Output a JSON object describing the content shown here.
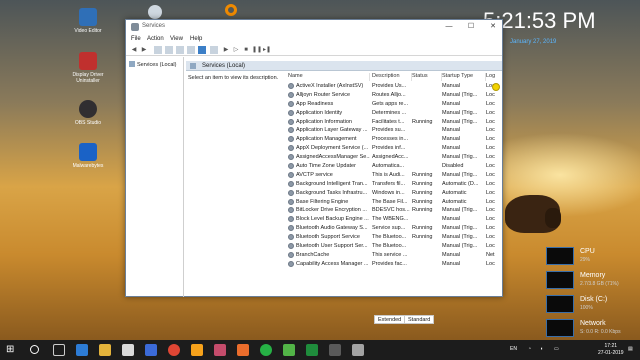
{
  "desktop": {
    "clock": "5:21:53 PM",
    "date": "January 27, 2019",
    "icons": [
      {
        "label": "Video Editor",
        "color": "#2f6fb7"
      },
      {
        "label": "Display Driver Uninstaller",
        "color": "#c0302e"
      },
      {
        "label": "OBS Studio",
        "color": "#302e31"
      },
      {
        "label": "Malwarebytes",
        "color": "#1a62c6"
      }
    ]
  },
  "perf_widget": [
    {
      "title": "CPU",
      "value": "29%"
    },
    {
      "title": "Memory",
      "value": "2.7/3.8 GB (71%)"
    },
    {
      "title": "Disk (C:)",
      "value": "100%"
    },
    {
      "title": "Network",
      "value": "S: 0.0 R: 0.0 Kbps"
    }
  ],
  "window": {
    "title": "Services",
    "buttons": {
      "minimize": "—",
      "maximize": "☐",
      "close": "✕"
    },
    "menu": [
      "File",
      "Action",
      "View",
      "Help"
    ],
    "left_pane_label": "Services (Local)",
    "header_label": "Services (Local)",
    "description_text": "Select an item to view its description.",
    "columns": [
      "Name",
      "Description",
      "Status",
      "Startup Type",
      "Log"
    ],
    "services": [
      {
        "name": "ActiveX Installer (AxInstSV)",
        "desc": "Provides Us...",
        "status": "",
        "startup": "Manual",
        "log": "Loc"
      },
      {
        "name": "Alljoyn Router Service",
        "desc": "Routes Alljo...",
        "status": "",
        "startup": "Manual (Trig...",
        "log": "Loc"
      },
      {
        "name": "App Readiness",
        "desc": "Gets apps re...",
        "status": "",
        "startup": "Manual",
        "log": "Loc"
      },
      {
        "name": "Application Identity",
        "desc": "Determines ...",
        "status": "",
        "startup": "Manual (Trig...",
        "log": "Loc"
      },
      {
        "name": "Application Information",
        "desc": "Facilitates t...",
        "status": "Running",
        "startup": "Manual (Trig...",
        "log": "Loc"
      },
      {
        "name": "Application Layer Gateway ...",
        "desc": "Provides su...",
        "status": "",
        "startup": "Manual",
        "log": "Loc"
      },
      {
        "name": "Application Management",
        "desc": "Processes in...",
        "status": "",
        "startup": "Manual",
        "log": "Loc"
      },
      {
        "name": "AppX Deployment Service (...",
        "desc": "Provides inf...",
        "status": "",
        "startup": "Manual",
        "log": "Loc"
      },
      {
        "name": "AssignedAccessManager Se...",
        "desc": "AssignedAcc...",
        "status": "",
        "startup": "Manual (Trig...",
        "log": "Loc"
      },
      {
        "name": "Auto Time Zone Updater",
        "desc": "Automatica...",
        "status": "",
        "startup": "Disabled",
        "log": "Loc"
      },
      {
        "name": "AVCTP service",
        "desc": "This is Audi...",
        "status": "Running",
        "startup": "Manual (Trig...",
        "log": "Loc"
      },
      {
        "name": "Background Intelligent Tran...",
        "desc": "Transfers fil...",
        "status": "Running",
        "startup": "Automatic (D...",
        "log": "Loc"
      },
      {
        "name": "Background Tasks Infrastru...",
        "desc": "Windows in...",
        "status": "Running",
        "startup": "Automatic",
        "log": "Loc"
      },
      {
        "name": "Base Filtering Engine",
        "desc": "The Base Fil...",
        "status": "Running",
        "startup": "Automatic",
        "log": "Loc"
      },
      {
        "name": "BitLocker Drive Encryption ...",
        "desc": "BDESVC hos...",
        "status": "Running",
        "startup": "Manual (Trig...",
        "log": "Loc"
      },
      {
        "name": "Block Level Backup Engine ...",
        "desc": "The WBENG...",
        "status": "",
        "startup": "Manual",
        "log": "Loc"
      },
      {
        "name": "Bluetooth Audio Gateway S...",
        "desc": "Service sup...",
        "status": "Running",
        "startup": "Manual (Trig...",
        "log": "Loc"
      },
      {
        "name": "Bluetooth Support Service",
        "desc": "The Bluetoo...",
        "status": "Running",
        "startup": "Manual (Trig...",
        "log": "Loc"
      },
      {
        "name": "Bluetooth User Support Ser...",
        "desc": "The Bluetoo...",
        "status": "",
        "startup": "Manual (Trig...",
        "log": "Loc"
      },
      {
        "name": "BranchCache",
        "desc": "This service ...",
        "status": "",
        "startup": "Manual",
        "log": "Net"
      },
      {
        "name": "Capability Access Manager ...",
        "desc": "Provides fac...",
        "status": "",
        "startup": "Manual",
        "log": "Loc"
      }
    ],
    "tabs": [
      "Extended",
      "Standard"
    ]
  },
  "taskbar": {
    "lang": "EN",
    "time": "17:21",
    "date": "27-01-2019"
  }
}
